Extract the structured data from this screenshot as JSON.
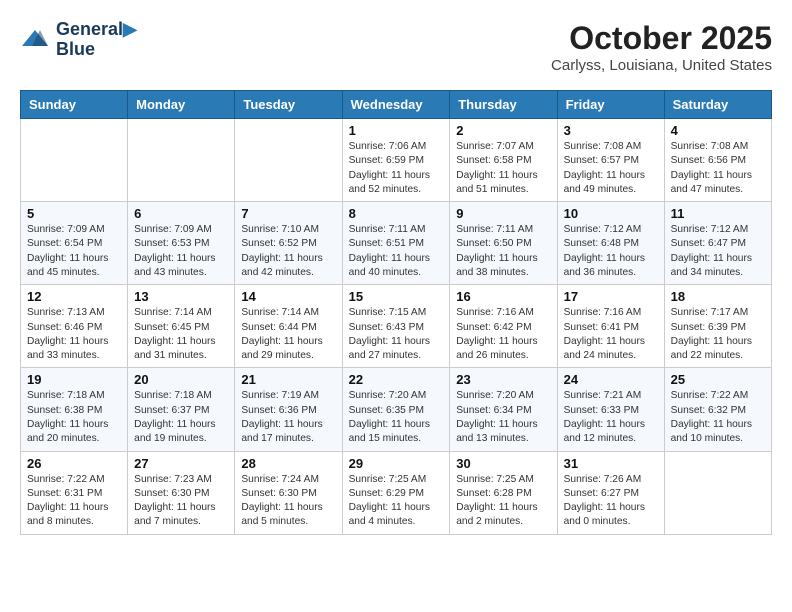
{
  "header": {
    "logo_line1": "General",
    "logo_line2": "Blue",
    "month": "October 2025",
    "location": "Carlyss, Louisiana, United States"
  },
  "weekdays": [
    "Sunday",
    "Monday",
    "Tuesday",
    "Wednesday",
    "Thursday",
    "Friday",
    "Saturday"
  ],
  "weeks": [
    [
      {
        "day": "",
        "content": ""
      },
      {
        "day": "",
        "content": ""
      },
      {
        "day": "",
        "content": ""
      },
      {
        "day": "1",
        "content": "Sunrise: 7:06 AM\nSunset: 6:59 PM\nDaylight: 11 hours\nand 52 minutes."
      },
      {
        "day": "2",
        "content": "Sunrise: 7:07 AM\nSunset: 6:58 PM\nDaylight: 11 hours\nand 51 minutes."
      },
      {
        "day": "3",
        "content": "Sunrise: 7:08 AM\nSunset: 6:57 PM\nDaylight: 11 hours\nand 49 minutes."
      },
      {
        "day": "4",
        "content": "Sunrise: 7:08 AM\nSunset: 6:56 PM\nDaylight: 11 hours\nand 47 minutes."
      }
    ],
    [
      {
        "day": "5",
        "content": "Sunrise: 7:09 AM\nSunset: 6:54 PM\nDaylight: 11 hours\nand 45 minutes."
      },
      {
        "day": "6",
        "content": "Sunrise: 7:09 AM\nSunset: 6:53 PM\nDaylight: 11 hours\nand 43 minutes."
      },
      {
        "day": "7",
        "content": "Sunrise: 7:10 AM\nSunset: 6:52 PM\nDaylight: 11 hours\nand 42 minutes."
      },
      {
        "day": "8",
        "content": "Sunrise: 7:11 AM\nSunset: 6:51 PM\nDaylight: 11 hours\nand 40 minutes."
      },
      {
        "day": "9",
        "content": "Sunrise: 7:11 AM\nSunset: 6:50 PM\nDaylight: 11 hours\nand 38 minutes."
      },
      {
        "day": "10",
        "content": "Sunrise: 7:12 AM\nSunset: 6:48 PM\nDaylight: 11 hours\nand 36 minutes."
      },
      {
        "day": "11",
        "content": "Sunrise: 7:12 AM\nSunset: 6:47 PM\nDaylight: 11 hours\nand 34 minutes."
      }
    ],
    [
      {
        "day": "12",
        "content": "Sunrise: 7:13 AM\nSunset: 6:46 PM\nDaylight: 11 hours\nand 33 minutes."
      },
      {
        "day": "13",
        "content": "Sunrise: 7:14 AM\nSunset: 6:45 PM\nDaylight: 11 hours\nand 31 minutes."
      },
      {
        "day": "14",
        "content": "Sunrise: 7:14 AM\nSunset: 6:44 PM\nDaylight: 11 hours\nand 29 minutes."
      },
      {
        "day": "15",
        "content": "Sunrise: 7:15 AM\nSunset: 6:43 PM\nDaylight: 11 hours\nand 27 minutes."
      },
      {
        "day": "16",
        "content": "Sunrise: 7:16 AM\nSunset: 6:42 PM\nDaylight: 11 hours\nand 26 minutes."
      },
      {
        "day": "17",
        "content": "Sunrise: 7:16 AM\nSunset: 6:41 PM\nDaylight: 11 hours\nand 24 minutes."
      },
      {
        "day": "18",
        "content": "Sunrise: 7:17 AM\nSunset: 6:39 PM\nDaylight: 11 hours\nand 22 minutes."
      }
    ],
    [
      {
        "day": "19",
        "content": "Sunrise: 7:18 AM\nSunset: 6:38 PM\nDaylight: 11 hours\nand 20 minutes."
      },
      {
        "day": "20",
        "content": "Sunrise: 7:18 AM\nSunset: 6:37 PM\nDaylight: 11 hours\nand 19 minutes."
      },
      {
        "day": "21",
        "content": "Sunrise: 7:19 AM\nSunset: 6:36 PM\nDaylight: 11 hours\nand 17 minutes."
      },
      {
        "day": "22",
        "content": "Sunrise: 7:20 AM\nSunset: 6:35 PM\nDaylight: 11 hours\nand 15 minutes."
      },
      {
        "day": "23",
        "content": "Sunrise: 7:20 AM\nSunset: 6:34 PM\nDaylight: 11 hours\nand 13 minutes."
      },
      {
        "day": "24",
        "content": "Sunrise: 7:21 AM\nSunset: 6:33 PM\nDaylight: 11 hours\nand 12 minutes."
      },
      {
        "day": "25",
        "content": "Sunrise: 7:22 AM\nSunset: 6:32 PM\nDaylight: 11 hours\nand 10 minutes."
      }
    ],
    [
      {
        "day": "26",
        "content": "Sunrise: 7:22 AM\nSunset: 6:31 PM\nDaylight: 11 hours\nand 8 minutes."
      },
      {
        "day": "27",
        "content": "Sunrise: 7:23 AM\nSunset: 6:30 PM\nDaylight: 11 hours\nand 7 minutes."
      },
      {
        "day": "28",
        "content": "Sunrise: 7:24 AM\nSunset: 6:30 PM\nDaylight: 11 hours\nand 5 minutes."
      },
      {
        "day": "29",
        "content": "Sunrise: 7:25 AM\nSunset: 6:29 PM\nDaylight: 11 hours\nand 4 minutes."
      },
      {
        "day": "30",
        "content": "Sunrise: 7:25 AM\nSunset: 6:28 PM\nDaylight: 11 hours\nand 2 minutes."
      },
      {
        "day": "31",
        "content": "Sunrise: 7:26 AM\nSunset: 6:27 PM\nDaylight: 11 hours\nand 0 minutes."
      },
      {
        "day": "",
        "content": ""
      }
    ]
  ]
}
